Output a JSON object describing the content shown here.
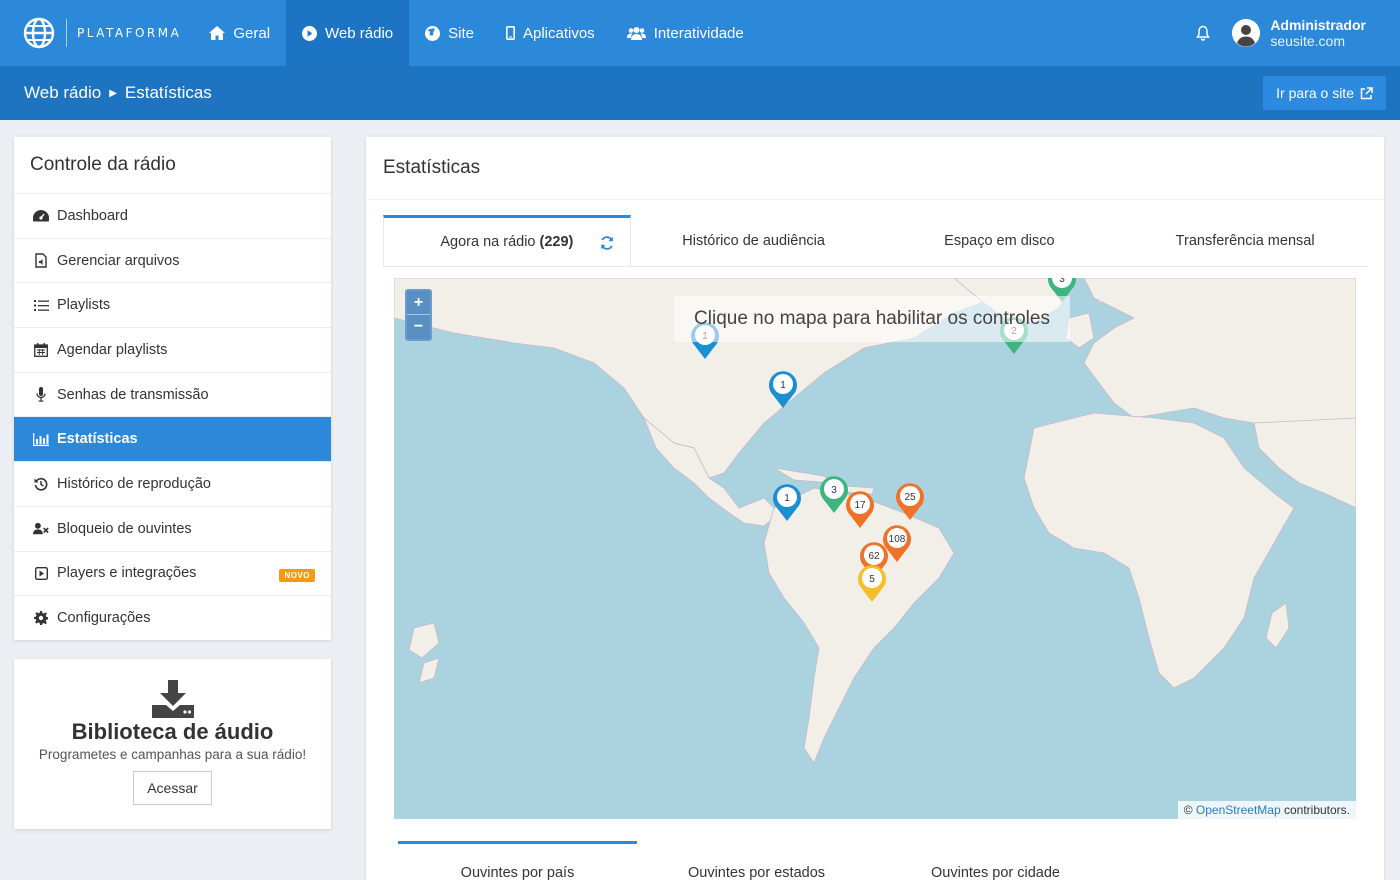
{
  "topbar": {
    "brand": "PLATAFORMA",
    "nav": [
      {
        "label": "Geral",
        "icon": "home-icon"
      },
      {
        "label": "Web rádio",
        "icon": "play-circle-icon",
        "active": true
      },
      {
        "label": "Site",
        "icon": "globe-icon"
      },
      {
        "label": "Aplicativos",
        "icon": "mobile-icon"
      },
      {
        "label": "Interatividade",
        "icon": "users-icon"
      }
    ],
    "user": {
      "name": "Administrador",
      "site": "seusite.com"
    }
  },
  "subbar": {
    "crumb_section": "Web rádio",
    "crumb_page": "Estatísticas",
    "go_site_label": "Ir para o site"
  },
  "sidebar": {
    "title": "Controle da rádio",
    "items": [
      {
        "label": "Dashboard",
        "icon": "dashboard-icon"
      },
      {
        "label": "Gerenciar arquivos",
        "icon": "file-audio-icon"
      },
      {
        "label": "Playlists",
        "icon": "list-icon"
      },
      {
        "label": "Agendar playlists",
        "icon": "calendar-icon"
      },
      {
        "label": "Senhas de transmissão",
        "icon": "microphone-icon"
      },
      {
        "label": "Estatísticas",
        "icon": "bar-chart-icon",
        "active": true
      },
      {
        "label": "Histórico de reprodução",
        "icon": "history-icon"
      },
      {
        "label": "Bloqueio de ouvintes",
        "icon": "user-block-icon"
      },
      {
        "label": "Players e integrações",
        "icon": "play-square-icon",
        "badge": "NOVO"
      },
      {
        "label": "Configurações",
        "icon": "gear-icon"
      }
    ]
  },
  "library": {
    "title": "Biblioteca de áudio",
    "subtitle": "Programetes e campanhas para a sua rádio!",
    "button": "Acessar"
  },
  "main": {
    "title": "Estatísticas",
    "tabs": [
      {
        "label": "Agora na rádio",
        "count": "(229)",
        "active": true
      },
      {
        "label": "Histórico de audiência"
      },
      {
        "label": "Espaço em disco"
      },
      {
        "label": "Transferência mensal"
      }
    ],
    "map": {
      "hint": "Clique no mapa para habilitar os controles",
      "zoom_in": "+",
      "zoom_out": "−",
      "attribution_prefix": "©",
      "attribution_link": "OpenStreetMap",
      "attribution_suffix": "contributors.",
      "markers": [
        {
          "count": "1",
          "color": "#1a8fd1"
        },
        {
          "count": "1",
          "color": "#1a8fd1"
        },
        {
          "count": "1",
          "color": "#1a8fd1"
        },
        {
          "count": "2",
          "color": "#3db57e"
        },
        {
          "count": "3",
          "color": "#3db57e"
        },
        {
          "count": "3",
          "color": "#3db57e"
        },
        {
          "count": "17",
          "color": "#f07128"
        },
        {
          "count": "25",
          "color": "#f07128"
        },
        {
          "count": "108",
          "color": "#f07128"
        },
        {
          "count": "62",
          "color": "#f07128"
        },
        {
          "count": "5",
          "color": "#f3c02b"
        }
      ]
    },
    "bottom_tabs": [
      {
        "label": "Ouvintes por país",
        "active": true
      },
      {
        "label": "Ouvintes por estados"
      },
      {
        "label": "Ouvintes por cidade"
      }
    ]
  },
  "colors": {
    "primary": "#2c88d9",
    "primary_dark": "#1f74c2",
    "badge": "#f39c12"
  }
}
